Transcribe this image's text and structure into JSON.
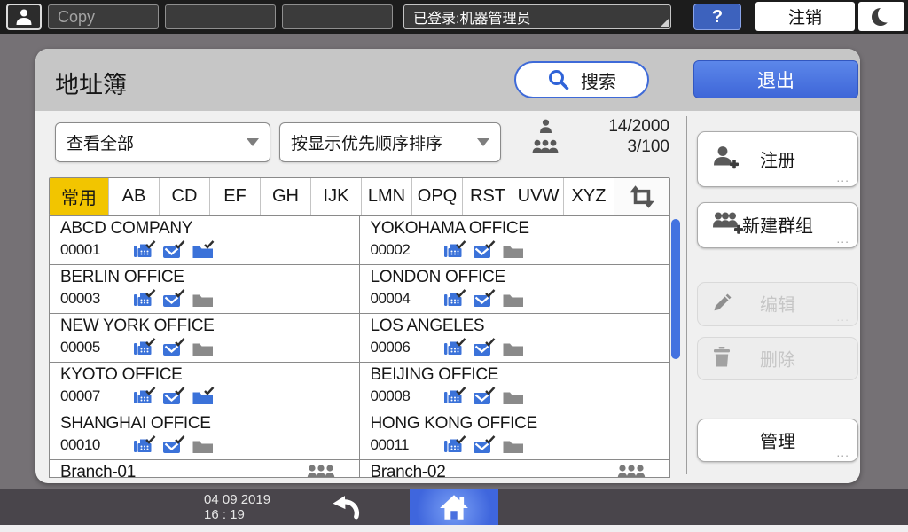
{
  "topbar": {
    "copy_button": "Copy",
    "login_status": "已登录:机器管理员",
    "help_button": "?",
    "logout_button": "注销"
  },
  "address_book": {
    "title": "地址簿",
    "search_button": "搜索",
    "exit_button": "退出",
    "view_filter": "查看全部",
    "sort_order": "按显示优先顺序排序",
    "user_count": "14/2000",
    "group_count": "3/100",
    "tabs": [
      "常用",
      "AB",
      "CD",
      "EF",
      "GH",
      "IJK",
      "LMN",
      "OPQ",
      "RST",
      "UVW",
      "XYZ"
    ],
    "active_tab": "常用",
    "contacts": [
      {
        "name": "ABCD COMPANY",
        "id": "00001",
        "fax": true,
        "email": true,
        "folder": "blue"
      },
      {
        "name": "YOKOHAMA OFFICE",
        "id": "00002",
        "fax": true,
        "email": true,
        "folder": "gray"
      },
      {
        "name": "BERLIN OFFICE",
        "id": "00003",
        "fax": true,
        "email": true,
        "folder": "gray"
      },
      {
        "name": "LONDON OFFICE",
        "id": "00004",
        "fax": true,
        "email": true,
        "folder": "gray"
      },
      {
        "name": "NEW YORK OFFICE",
        "id": "00005",
        "fax": true,
        "email": true,
        "folder": "gray"
      },
      {
        "name": "LOS ANGELES",
        "id": "00006",
        "fax": true,
        "email": true,
        "folder": "gray"
      },
      {
        "name": "KYOTO OFFICE",
        "id": "00007",
        "fax": true,
        "email": true,
        "folder": "blue"
      },
      {
        "name": "BEIJING OFFICE",
        "id": "00008",
        "fax": true,
        "email": true,
        "folder": "gray"
      },
      {
        "name": "SHANGHAI OFFICE",
        "id": "00010",
        "fax": true,
        "email": true,
        "folder": "gray"
      },
      {
        "name": "HONG KONG OFFICE",
        "id": "00011",
        "fax": true,
        "email": true,
        "folder": "gray"
      },
      {
        "name": "Branch-01",
        "type": "group"
      },
      {
        "name": "Branch-02",
        "type": "group"
      }
    ],
    "sidebar": {
      "register": "注册",
      "new_group": "新建群组",
      "edit": "编辑",
      "delete": "删除",
      "manage": "管理",
      "more_marker": "..."
    }
  },
  "footer": {
    "date": "04 09 2019",
    "time": "16 : 19"
  },
  "colors": {
    "accent_blue": "#4470DC",
    "tab_active_yellow": "#F2C500",
    "icon_blue": "#3B72D9",
    "icon_gray": "#8A8A8A"
  }
}
